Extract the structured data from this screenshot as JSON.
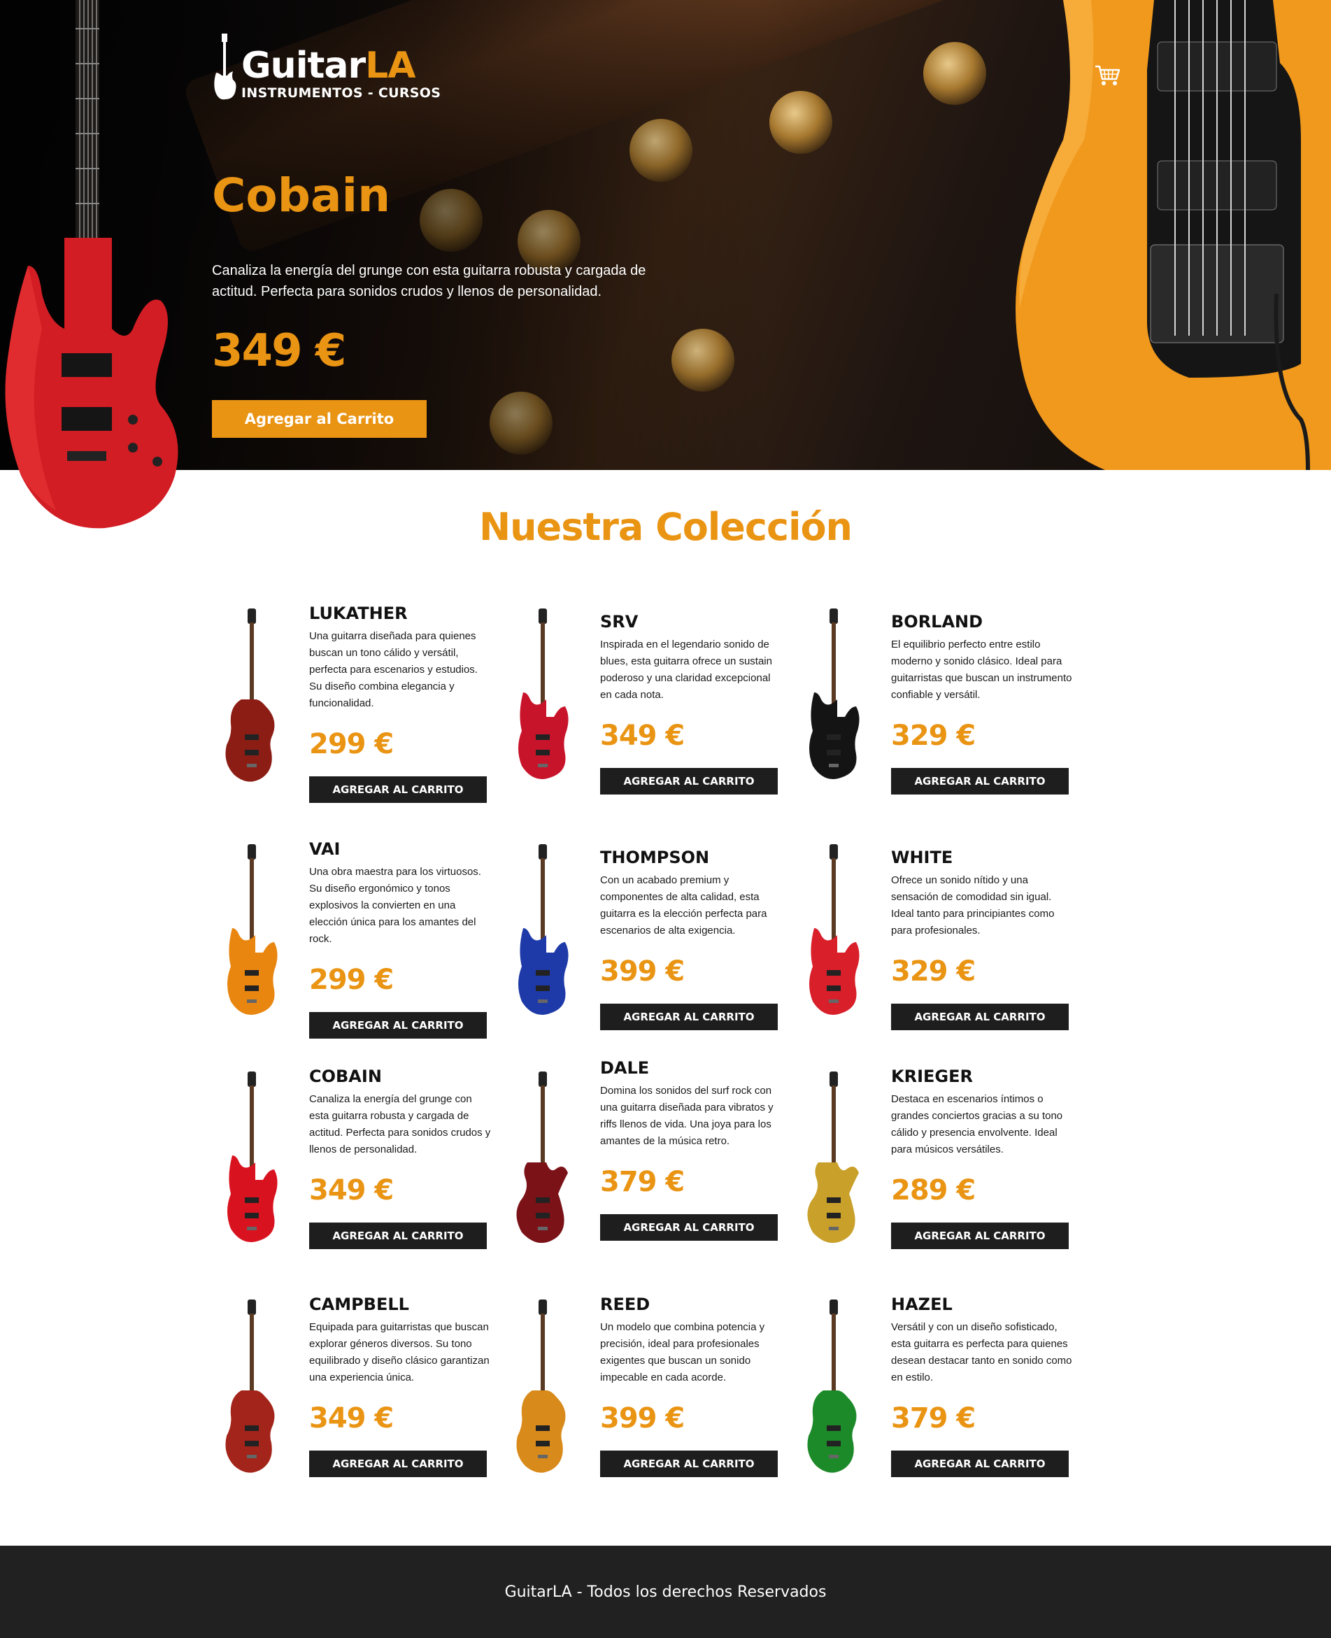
{
  "brand": {
    "name_main": "Guitar",
    "name_accent": "LA",
    "tagline": "INSTRUMENTOS - CURSOS"
  },
  "header": {
    "cart_icon": "cart-icon"
  },
  "hero": {
    "title": "Cobain",
    "description": "Canaliza la energía del grunge con esta guitarra robusta y cargada de actitud. Perfecta para sonidos crudos y llenos de personalidad.",
    "price": "349 €",
    "button_label": "Agregar al Carrito"
  },
  "collection": {
    "title": "Nuestra Colección",
    "button_label": "AGREGAR AL CARRITO",
    "items": [
      {
        "name": "Lukather",
        "description": "Una guitarra diseñada para quienes buscan un tono cálido y versátil, perfecta para escenarios y estudios. Su diseño combina elegancia y funcionalidad.",
        "price": "299 €",
        "color": "#8c1d14",
        "style": "lp"
      },
      {
        "name": "SRV",
        "description": "Inspirada en el legendario sonido de blues, esta guitarra ofrece un sustain poderoso y una claridad excepcional en cada nota.",
        "price": "349 €",
        "color": "#c8142a",
        "style": "st"
      },
      {
        "name": "Borland",
        "description": "El equilibrio perfecto entre estilo moderno y sonido clásico. Ideal para guitarristas que buscan un instrumento confiable y versátil.",
        "price": "329 €",
        "color": "#141414",
        "style": "st"
      },
      {
        "name": "Vai",
        "description": "Una obra maestra para los virtuosos. Su diseño ergonómico y tonos explosivos la convierten en una elección única para los amantes del rock.",
        "price": "299 €",
        "color": "#e8860f",
        "style": "st"
      },
      {
        "name": "Thompson",
        "description": "Con un acabado premium y componentes de alta calidad, esta guitarra es la elección perfecta para escenarios de alta exigencia.",
        "price": "399 €",
        "color": "#1d3aa8",
        "style": "st"
      },
      {
        "name": "White",
        "description": "Ofrece un sonido nítido y una sensación de comodidad sin igual. Ideal tanto para principiantes como para profesionales.",
        "price": "329 €",
        "color": "#d81f2a",
        "style": "st"
      },
      {
        "name": "Cobain",
        "description": "Canaliza la energía del grunge con esta guitarra robusta y cargada de actitud. Perfecta para sonidos crudos y llenos de personalidad.",
        "price": "349 €",
        "color": "#d8131f",
        "style": "st"
      },
      {
        "name": "Dale",
        "description": "Domina los sonidos del surf rock con una guitarra diseñada para vibratos y riffs llenos de vida. Una joya para los amantes de la música retro.",
        "price": "379 €",
        "color": "#7a1218",
        "style": "sg"
      },
      {
        "name": "Krieger",
        "description": "Destaca en escenarios íntimos o grandes conciertos gracias a su tono cálido y presencia envolvente. Ideal para músicos versátiles.",
        "price": "289 €",
        "color": "#c9a02a",
        "style": "sg"
      },
      {
        "name": "Campbell",
        "description": "Equipada para guitarristas que buscan explorar géneros diversos. Su tono equilibrado y diseño clásico garantizan una experiencia única.",
        "price": "349 €",
        "color": "#a3241a",
        "style": "lp"
      },
      {
        "name": "Reed",
        "description": "Un modelo que combina potencia y precisión, ideal para profesionales exigentes que buscan un sonido impecable en cada acorde.",
        "price": "399 €",
        "color": "#d88a1a",
        "style": "lp"
      },
      {
        "name": "Hazel",
        "description": "Versátil y con un diseño sofisticado, esta guitarra es perfecta para quienes desean destacar tanto en sonido como en estilo.",
        "price": "379 €",
        "color": "#1d8a2a",
        "style": "lp"
      }
    ]
  },
  "footer": {
    "text": "GuitarLA - Todos los derechos Reservados"
  }
}
